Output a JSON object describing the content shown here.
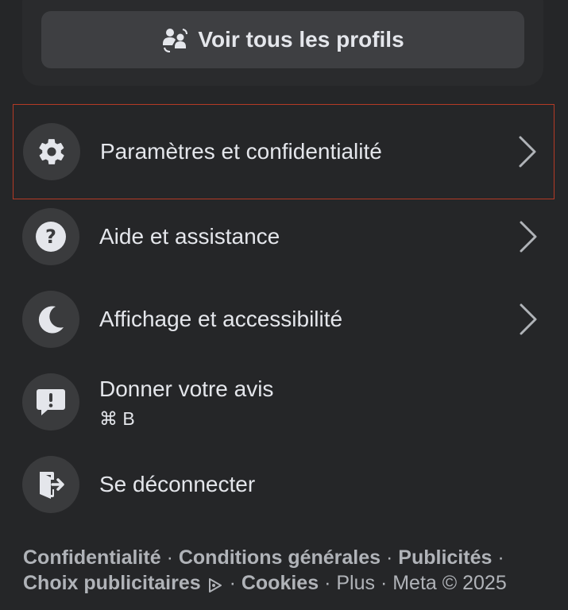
{
  "profiles_button": {
    "label": "Voir tous les profils",
    "icon": "switch-profiles-icon"
  },
  "menu": [
    {
      "label": "Paramètres et confidentialité",
      "icon": "gear-icon",
      "has_chevron": true,
      "selected": true
    },
    {
      "label": "Aide et assistance",
      "icon": "question-icon",
      "has_chevron": true
    },
    {
      "label": "Affichage et accessibilité",
      "icon": "moon-icon",
      "has_chevron": true
    },
    {
      "label": "Donner votre avis",
      "shortcut": "⌘ B",
      "icon": "feedback-icon",
      "has_chevron": false
    },
    {
      "label": "Se déconnecter",
      "icon": "logout-icon",
      "has_chevron": false
    }
  ],
  "footer": {
    "links": [
      "Confidentialité",
      "Conditions générales",
      "Publicités",
      "Choix publicitaires",
      "Cookies"
    ],
    "more": "Plus",
    "copyright": "Meta © 2025",
    "separator": "·"
  },
  "colors": {
    "background": "#252628",
    "selected_border": "#b43a26",
    "text": "#e4e6eb",
    "muted": "#b0b3b8"
  }
}
